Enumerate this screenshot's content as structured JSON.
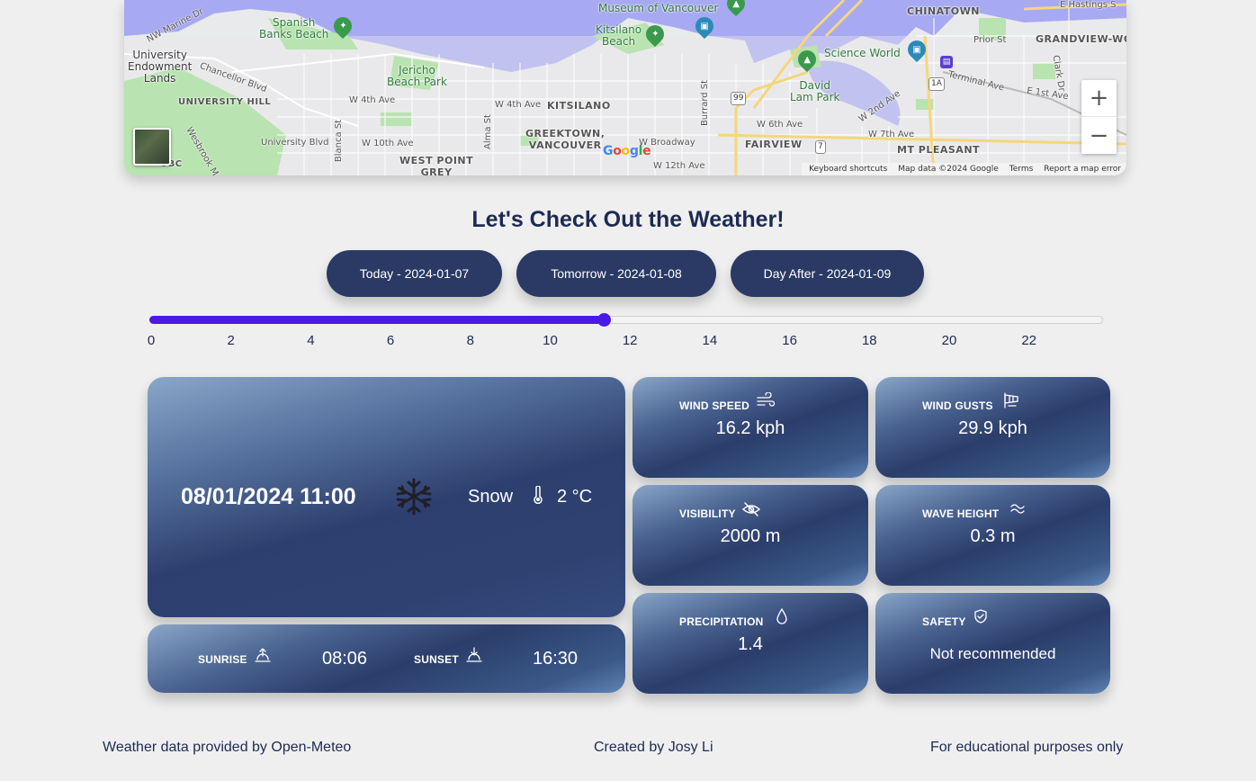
{
  "map": {
    "labels": {
      "nw_marine": "NW Marine Dr",
      "spanish_banks": "Spanish\nBanks Beach",
      "university": "University\nEndowment\nLands",
      "chancellor": "Chancellor Blvd",
      "university_hill": "UNIVERSITY HILL",
      "university_blvd": "University Blvd",
      "wesbrook": "Wesbrook M",
      "ubc": "UBC",
      "jericho": "Jericho\nBeach Park",
      "w4th": "W 4th Ave",
      "w10th": "W 10th Ave",
      "blanca": "Blanca St",
      "alma": "Alma St",
      "west_point_grey": "WEST POINT\nGREY",
      "greektown": "GREEKTOWN,\nVANCOUVER",
      "kitsilano": "KITSILANO",
      "kitsilano_beach": "Kitsilano\nBeach",
      "museum": "Museum of Vancouver",
      "w4th_2": "W 4th Ave",
      "w_broadway": "W Broadway",
      "w12th": "W 12th Ave",
      "burrard": "Burrard St",
      "fairview": "FAIRVIEW",
      "w6th": "W 6th Ave",
      "david_lam": "David\nLam Park",
      "science_world": "Science World",
      "chinatown": "CHINATOWN",
      "e_hastings": "E Hastings S",
      "prior": "Prior St",
      "grandview": "GRANDVIEW-WOO",
      "terminal": "Terminal Ave",
      "e1st": "E 1st Ave",
      "w2nd": "W 2nd Ave",
      "w7th": "W 7th Ave",
      "mt_pleasant": "MT PLEASANT",
      "clark": "Clark Dr",
      "route99": "99",
      "route1a": "1A",
      "route7": "7"
    },
    "google_logo": "Google",
    "footer": {
      "shortcuts": "Keyboard shortcuts",
      "map_data": "Map data ©2024 Google",
      "terms": "Terms",
      "report": "Report a map error"
    },
    "zoom_in": "+",
    "zoom_out": "−"
  },
  "title": "Let's Check Out the Weather!",
  "days": [
    {
      "label": "Today - 2024-01-07"
    },
    {
      "label": "Tomorrow - 2024-01-08"
    },
    {
      "label": "Day After - 2024-01-09"
    }
  ],
  "slider": {
    "ticks": [
      "0",
      "2",
      "4",
      "6",
      "8",
      "10",
      "12",
      "14",
      "16",
      "18",
      "20",
      "22"
    ],
    "value_hour": 11,
    "max_hour": 23,
    "accent": "#4a19e8"
  },
  "main": {
    "datetime": "08/01/2024 11:00",
    "condition": "Snow",
    "temperature": "2 °C",
    "icon": "snowflake-icon"
  },
  "sun": {
    "sunrise_label": "SUNRISE",
    "sunrise": "08:06",
    "sunset_label": "SUNSET",
    "sunset": "16:30"
  },
  "metrics": {
    "wind_speed": {
      "label": "WIND SPEED",
      "value": "16.2 kph",
      "icon": "wind-icon"
    },
    "wind_gusts": {
      "label": "WIND GUSTS",
      "value": "29.9 kph",
      "icon": "windsock-icon"
    },
    "visibility": {
      "label": "VISIBILITY",
      "value": "2000 m",
      "icon": "eye-off-icon"
    },
    "wave_height": {
      "label": "WAVE HEIGHT",
      "value": "0.3 m",
      "icon": "waves-icon"
    },
    "precipitation": {
      "label": "PRECIPITATION",
      "value": "1.4",
      "icon": "droplet-icon"
    },
    "safety": {
      "label": "SAFETY",
      "value": "Not recommended",
      "icon": "shield-check-icon"
    }
  },
  "footer": {
    "left": "Weather data provided by Open-Meteo",
    "center": "Created by Josy Li",
    "right": "For educational purposes only"
  },
  "colors": {
    "card_dark": "#2b3d6b",
    "card_light": "#8aa6c7",
    "button": "#2b3a64",
    "text_dark": "#1e2a52",
    "water": "#a7a9f2",
    "park": "#b9e3b0"
  }
}
